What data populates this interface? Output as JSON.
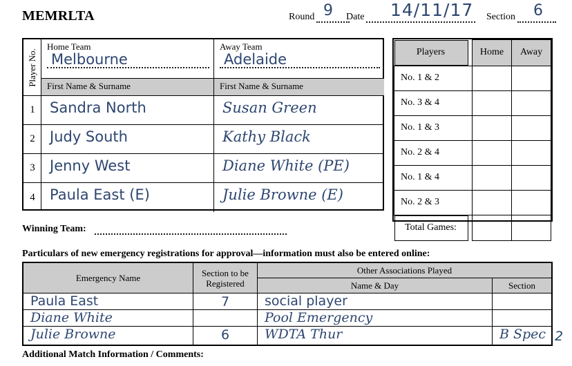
{
  "header": {
    "title": "MEMRLTA",
    "round_label": "Round",
    "round_value": "9",
    "date_label": "Date",
    "date_value": "14/11/17",
    "section_label": "Section",
    "section_value": "6"
  },
  "main_table": {
    "player_no_label": "Player No.",
    "home": {
      "team_label": "Home Team",
      "team_value": "Melbourne",
      "name_header": "First Name & Surname"
    },
    "away": {
      "team_label": "Away Team",
      "team_value": "Adelaide",
      "name_header": "First Name & Surname"
    },
    "rows": [
      {
        "no": "1",
        "home": "Sandra North",
        "away": "Susan Green"
      },
      {
        "no": "2",
        "home": "Judy South",
        "away": "Kathy Black"
      },
      {
        "no": "3",
        "home": "Jenny West",
        "away": "Diane White (PE)"
      },
      {
        "no": "4",
        "home": "Paula East (E)",
        "away": "Julie Browne (E)"
      }
    ]
  },
  "players_table": {
    "headers": [
      "Players",
      "Home",
      "Away"
    ],
    "rows": [
      {
        "label": "No. 1 & 2",
        "home": "",
        "away": ""
      },
      {
        "label": "No. 3 & 4",
        "home": "",
        "away": ""
      },
      {
        "label": "No. 1 & 3",
        "home": "",
        "away": ""
      },
      {
        "label": "No. 2 & 4",
        "home": "",
        "away": ""
      },
      {
        "label": "No. 1 & 4",
        "home": "",
        "away": ""
      },
      {
        "label": "No. 2 & 3",
        "home": "",
        "away": ""
      },
      {
        "label": "Total Games:",
        "home": "",
        "away": ""
      }
    ]
  },
  "winning_team": {
    "label": "Winning Team:",
    "value": ""
  },
  "particulars_heading": "Particulars of new emergency registrations for approval—information must also be entered online:",
  "emergency_table": {
    "headers": {
      "emergency_name": "Emergency Name",
      "section_to_be_registered": "Section to be Registered",
      "section_to_be_registered_line1": "Section to be",
      "section_to_be_registered_line2": "Registered",
      "other_associations": "Other Associations Played",
      "name_and_day": "Name & Day",
      "section": "Section"
    },
    "rows": [
      {
        "name": "Paula East",
        "section_reg": "7",
        "name_day": "social player",
        "section": ""
      },
      {
        "name": "Diane White",
        "section_reg": "",
        "name_day": "Pool Emergency",
        "section": ""
      },
      {
        "name": "Julie Browne",
        "section_reg": "6",
        "name_day": "WDTA Thur",
        "section": "B Spec"
      }
    ],
    "overflow_section_value": "2"
  },
  "footer": {
    "label": "Additional Match Information / Comments:"
  },
  "colors": {
    "ink": "#2d4670",
    "header_fill": "#cccccc",
    "rule": "#000000"
  }
}
